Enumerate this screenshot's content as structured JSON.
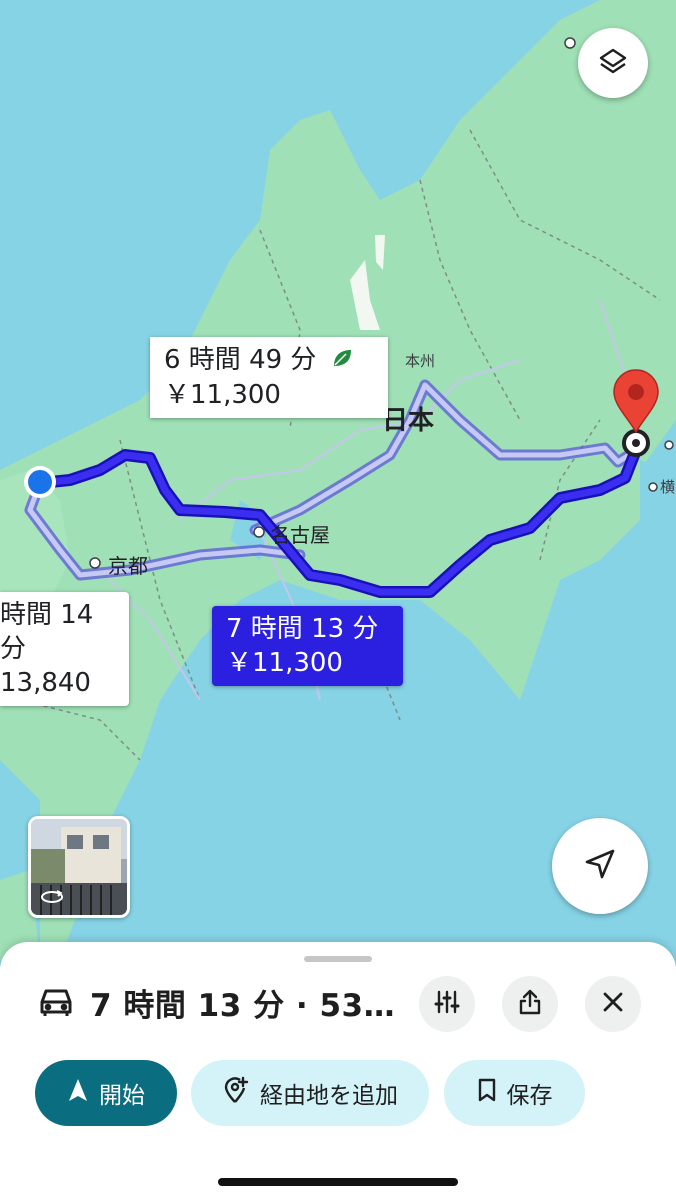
{
  "map": {
    "places": {
      "nihon": "日本",
      "honshu": "本州",
      "nagoya": "名古屋",
      "kyoto": "京都",
      "yoko": "横"
    },
    "routes": [
      {
        "time": "6 時間 49 分",
        "fare": "￥11,300",
        "eco_icon": "leaf-icon",
        "selected": false
      },
      {
        "time": "7 時間 13 分",
        "fare": "￥11,300",
        "selected": true
      },
      {
        "time": "時間 14 分",
        "fare": "13,840",
        "selected": false
      }
    ],
    "colors": {
      "selected_route": "#2b1fe0",
      "alt_route": "#b9bdf2",
      "water": "#86d3e6",
      "land": "#9fe0b6",
      "pin": "#ea4335"
    }
  },
  "buttons": {
    "layers_icon": "layers-icon",
    "recenter_icon": "navigation-arrow-icon"
  },
  "sheet": {
    "mode_icon": "car-icon",
    "summary": "7 時間 13 分 · 53…",
    "start_label": "開始",
    "add_stop_label": "経由地を追加",
    "save_label": "保存"
  }
}
